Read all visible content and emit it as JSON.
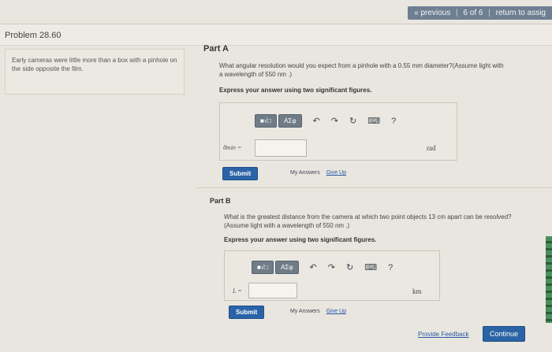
{
  "nav": {
    "previous": "« previous",
    "sep1": "|",
    "page": "6 of 6",
    "sep2": "|",
    "return": "return to assig"
  },
  "problem": {
    "title": "Problem 28.60",
    "intro": "Early cameras were little more than a box with a pinhole on the side opposite the film."
  },
  "part_a": {
    "label": "Part A",
    "question_line1": "What angular resolution would you expect from a pinhole with a 0.55 mm diameter?(Assume light with",
    "question_line2": "a wavelength of 550 nm .)",
    "instruction": "Express your answer using two significant figures.",
    "variable": "θmin =",
    "input_value": "",
    "unit": "rad",
    "submit": "Submit",
    "my_answers": "My Answers",
    "give_up": "Give Up"
  },
  "part_b": {
    "label": "Part B",
    "question_line1": "What is the greatest distance from the camera at which two point objects 13 cm apart can be resolved?",
    "question_line2": "(Assume light with a wavelength of 550 nm .)",
    "instruction": "Express your answer using two significant figures.",
    "variable": "L =",
    "input_value": "",
    "unit": "km",
    "submit": "Submit",
    "my_answers": "My Answers",
    "give_up": "Give Up"
  },
  "toolbar": {
    "template_btn": "■√□",
    "symbol_btn": "ΑΣφ",
    "undo": "↶",
    "redo": "↷",
    "reset": "↻",
    "keyboard": "⌨",
    "help": "?"
  },
  "footer": {
    "feedback": "Provide Feedback",
    "continue": "Continue"
  }
}
